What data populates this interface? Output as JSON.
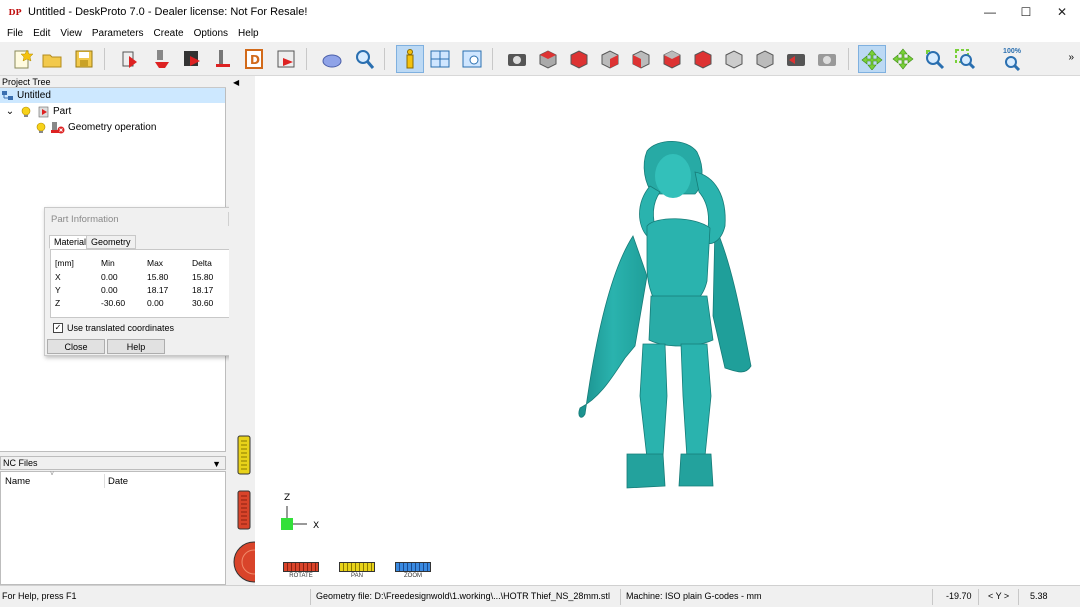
{
  "window": {
    "title": "Untitled - DeskProto 7.0 - Dealer license: Not For Resale!",
    "logo_text": "DP",
    "controls": [
      "—",
      "☐",
      "✕"
    ]
  },
  "menu": [
    "File",
    "Edit",
    "View",
    "Parameters",
    "Create",
    "Options",
    "Help"
  ],
  "toolbar": {
    "zoom_label": "100%",
    "more": "»"
  },
  "project_tree": {
    "header": "Project Tree",
    "items": [
      {
        "label": "Untitled"
      },
      {
        "label": "Part",
        "expander": "⌄"
      },
      {
        "label": "Geometry operation"
      }
    ]
  },
  "dialog": {
    "title": "Part Information",
    "tabs": [
      "Material",
      "Geometry"
    ],
    "columns": [
      "[mm]",
      "Min",
      "Max",
      "Delta"
    ],
    "rows": [
      {
        "axis": "X",
        "min": "0.00",
        "max": "15.80",
        "delta": "15.80"
      },
      {
        "axis": "Y",
        "min": "0.00",
        "max": "18.17",
        "delta": "18.17"
      },
      {
        "axis": "Z",
        "min": "-30.60",
        "max": "0.00",
        "delta": "30.60"
      }
    ],
    "checkbox_label": "Use translated coordinates",
    "checkbox_checked": true,
    "close_label": "Close",
    "help_label": "Help"
  },
  "nc_files": {
    "header": "NC Files",
    "columns": [
      "Name",
      "Date"
    ]
  },
  "viewport": {
    "axis_z": "Z",
    "axis_x": "X",
    "pads": [
      "ROTATE",
      "PAN",
      "ZOOM"
    ],
    "model_color": "#2ab3ae",
    "background": "#ffffff"
  },
  "statusbar": {
    "help": "For Help, press F1",
    "geometry_file": "Geometry file: D:\\Freedesignwold\\1.working\\...\\HOTR Thief_NS_28mm.stl",
    "machine": "Machine: ISO plain G-codes - mm",
    "coord_value": "-19.70",
    "coord_axis": "< Y >",
    "coord_second": "5.38"
  }
}
